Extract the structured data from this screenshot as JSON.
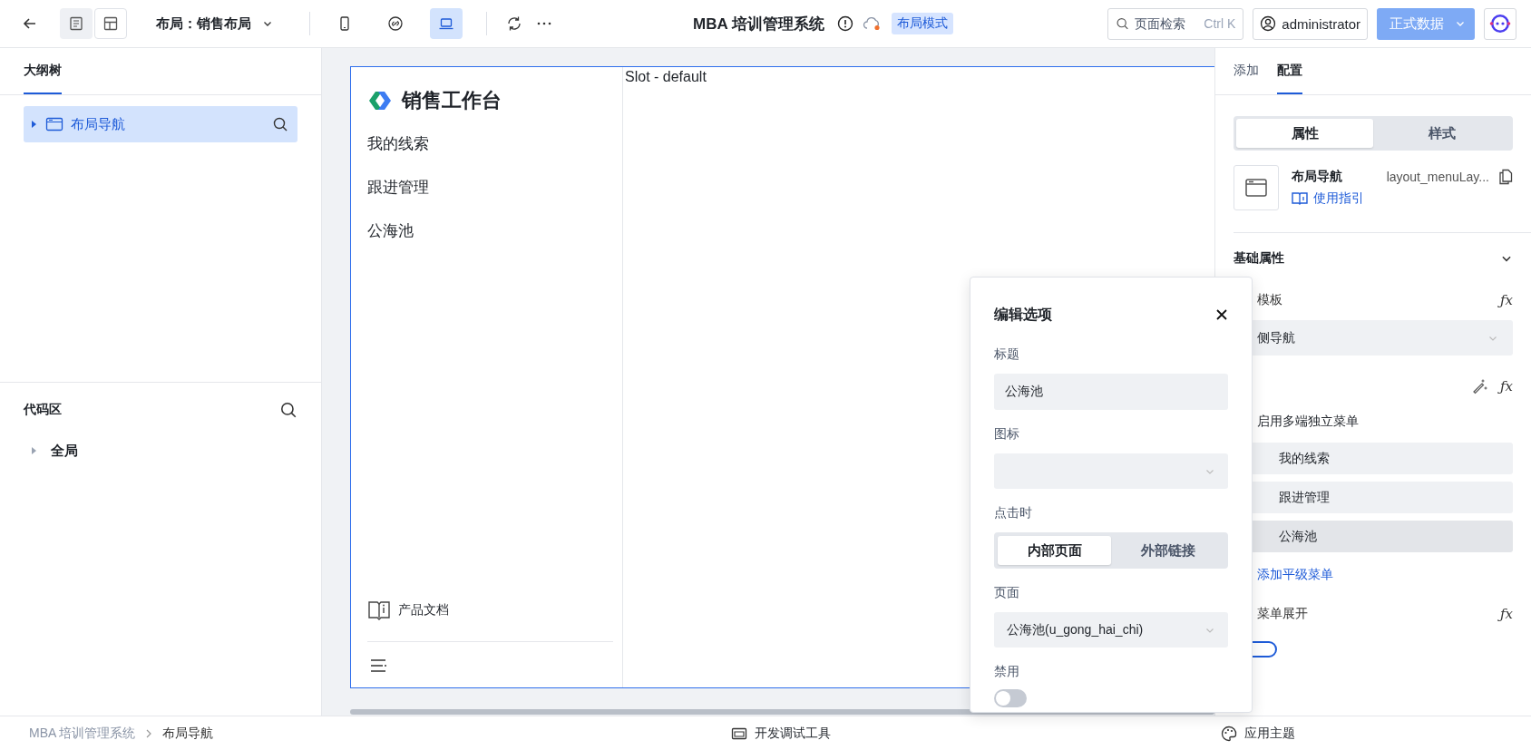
{
  "toolbar": {
    "view_toggles": [
      {
        "kind": "page",
        "selected": true
      },
      {
        "kind": "layout",
        "selected": false
      }
    ],
    "layout_selector": "布局：销售布局",
    "devices": [
      {
        "kind": "phone",
        "selected": false
      },
      {
        "kind": "link",
        "selected": false
      },
      {
        "kind": "laptop",
        "selected": true
      }
    ],
    "app_title": "MBA 培训管理系统",
    "mode_badge": "布局模式",
    "search": {
      "placeholder": "页面检索",
      "shortcut": "Ctrl K"
    },
    "user": "administrator",
    "data_source": {
      "label": "正式数据",
      "disabled": true
    }
  },
  "left_panel": {
    "tabs": [
      {
        "label": "大纲树",
        "selected": true
      }
    ],
    "tree": [
      {
        "label": "布局导航",
        "selected": true
      }
    ],
    "code_area": {
      "title": "代码区",
      "items": [
        {
          "label": "全局"
        }
      ]
    }
  },
  "canvas": {
    "brand": "销售工作台",
    "menu": [
      "我的线索",
      "跟进管理",
      "公海池"
    ],
    "docs": "产品文档",
    "slot": "Slot - default"
  },
  "right_panel": {
    "tabs": [
      {
        "label": "添加",
        "selected": false
      },
      {
        "label": "配置",
        "selected": true
      }
    ],
    "segments": [
      {
        "label": "属性",
        "selected": true
      },
      {
        "label": "样式",
        "selected": false
      }
    ],
    "component": {
      "name": "布局导航",
      "id": "layout_menuLay...",
      "guide": "使用指引"
    },
    "section": "基础属性",
    "template": {
      "label": "模板",
      "fx": "ƒx",
      "value": "侧导航"
    },
    "menu_row": {
      "fx": "ƒx"
    },
    "multi_menu": {
      "label": "启用多端独立菜单"
    },
    "menu_items": [
      {
        "label": "我的线索",
        "selected": false
      },
      {
        "label": "跟进管理",
        "selected": false
      },
      {
        "label": "公海池",
        "selected": true
      }
    ],
    "add_menu": "添加平级菜单",
    "expand": {
      "label": "菜单展开",
      "fx": "ƒx",
      "on": false
    }
  },
  "dialog": {
    "title": "编辑选项",
    "title_field": {
      "label": "标题",
      "value": "公海池"
    },
    "icon_field": {
      "label": "图标"
    },
    "click": {
      "label": "点击时",
      "options": [
        {
          "label": "内部页面",
          "selected": true
        },
        {
          "label": "外部链接",
          "selected": false
        }
      ]
    },
    "page_field": {
      "label": "页面",
      "value": "公海池(u_gong_hai_chi)"
    },
    "disabled_field": {
      "label": "禁用",
      "on": false
    }
  },
  "status_bar": {
    "breadcrumb": [
      "MBA 培训管理系统",
      "布局导航"
    ],
    "dev_tools": "开发调试工具",
    "theme": "应用主题"
  }
}
